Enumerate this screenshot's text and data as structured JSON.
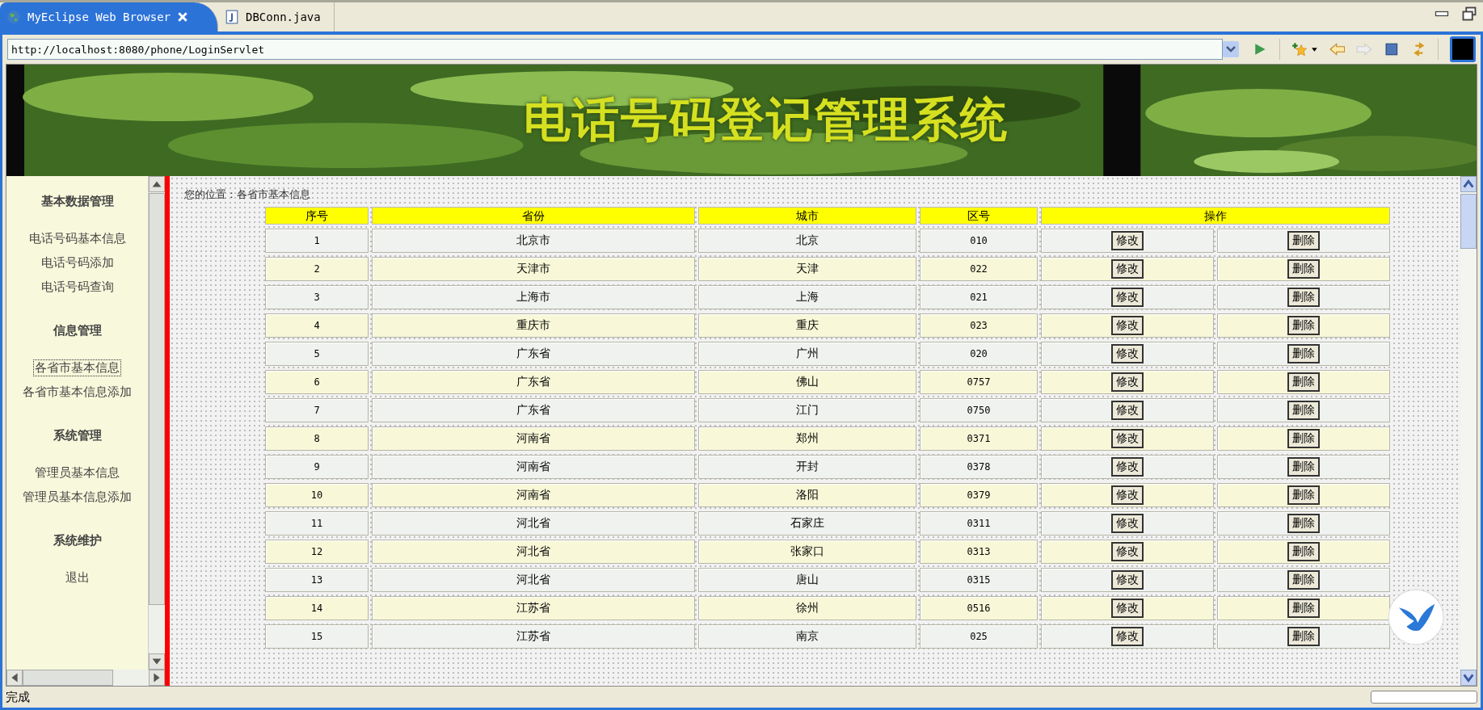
{
  "tabs": [
    {
      "label": "MyEclipse Web Browser",
      "selected": true,
      "kind": "browser"
    },
    {
      "label": "DBConn.java",
      "selected": false,
      "kind": "java"
    }
  ],
  "address": {
    "value": "http://localhost:8080/phone/LoginServlet"
  },
  "banner": {
    "title": "电话号码登记管理系统"
  },
  "sidebar": {
    "sections": [
      {
        "heading": "基本数据管理",
        "items": [
          {
            "label": "电话号码基本信息",
            "selected": false
          },
          {
            "label": "电话号码添加",
            "selected": false
          },
          {
            "label": "电话号码查询",
            "selected": false
          }
        ]
      },
      {
        "heading": "信息管理",
        "items": [
          {
            "label": "各省市基本信息",
            "selected": true
          },
          {
            "label": "各省市基本信息添加",
            "selected": false
          }
        ]
      },
      {
        "heading": "系统管理",
        "items": [
          {
            "label": "管理员基本信息",
            "selected": false
          },
          {
            "label": "管理员基本信息添加",
            "selected": false
          }
        ]
      },
      {
        "heading": "系统维护",
        "items": [
          {
            "label": "退出",
            "selected": false
          }
        ]
      }
    ]
  },
  "breadcrumb": "您的位置：各省市基本信息",
  "table": {
    "columns": [
      "序号",
      "省份",
      "城市",
      "区号",
      "操作"
    ],
    "rows": [
      {
        "no": "1",
        "province": "北京市",
        "city": "北京",
        "code": "010",
        "edit": "修改",
        "delete": "删除"
      },
      {
        "no": "2",
        "province": "天津市",
        "city": "天津",
        "code": "022",
        "edit": "修改",
        "delete": "删除"
      },
      {
        "no": "3",
        "province": "上海市",
        "city": "上海",
        "code": "021",
        "edit": "修改",
        "delete": "删除"
      },
      {
        "no": "4",
        "province": "重庆市",
        "city": "重庆",
        "code": "023",
        "edit": "修改",
        "delete": "删除"
      },
      {
        "no": "5",
        "province": "广东省",
        "city": "广州",
        "code": "020",
        "edit": "修改",
        "delete": "删除"
      },
      {
        "no": "6",
        "province": "广东省",
        "city": "佛山",
        "code": "0757",
        "edit": "修改",
        "delete": "删除"
      },
      {
        "no": "7",
        "province": "广东省",
        "city": "江门",
        "code": "0750",
        "edit": "修改",
        "delete": "删除"
      },
      {
        "no": "8",
        "province": "河南省",
        "city": "郑州",
        "code": "0371",
        "edit": "修改",
        "delete": "删除"
      },
      {
        "no": "9",
        "province": "河南省",
        "city": "开封",
        "code": "0378",
        "edit": "修改",
        "delete": "删除"
      },
      {
        "no": "10",
        "province": "河南省",
        "city": "洛阳",
        "code": "0379",
        "edit": "修改",
        "delete": "删除"
      },
      {
        "no": "11",
        "province": "河北省",
        "city": "石家庄",
        "code": "0311",
        "edit": "修改",
        "delete": "删除"
      },
      {
        "no": "12",
        "province": "河北省",
        "city": "张家口",
        "code": "0313",
        "edit": "修改",
        "delete": "删除"
      },
      {
        "no": "13",
        "province": "河北省",
        "city": "唐山",
        "code": "0315",
        "edit": "修改",
        "delete": "删除"
      },
      {
        "no": "14",
        "province": "江苏省",
        "city": "徐州",
        "code": "0516",
        "edit": "修改",
        "delete": "删除"
      },
      {
        "no": "15",
        "province": "江苏省",
        "city": "南京",
        "code": "025",
        "edit": "修改",
        "delete": "删除"
      }
    ]
  },
  "status_bar": {
    "text": "完成"
  }
}
